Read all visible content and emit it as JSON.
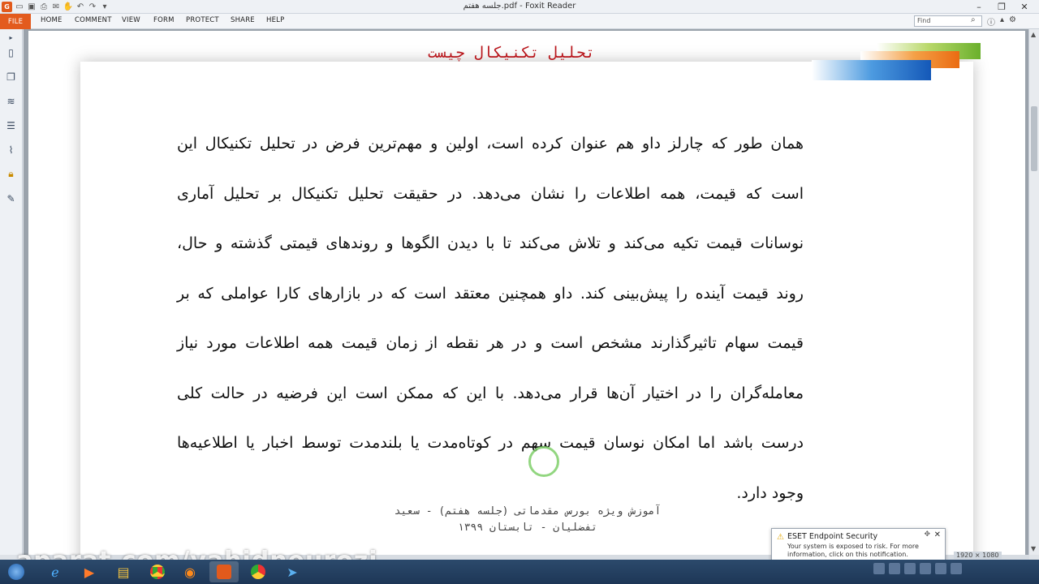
{
  "window": {
    "title": "جلسه هفتم.pdf - Foxit Reader",
    "app_icon_label": "G"
  },
  "ribbon": {
    "tabs": [
      "FILE",
      "HOME",
      "COMMENT",
      "VIEW",
      "FORM",
      "PROTECT",
      "SHARE",
      "HELP"
    ],
    "find_placeholder": "Find"
  },
  "sidebar": {
    "icons": [
      "bookmark-icon",
      "pages-icon",
      "layers-icon",
      "comments-icon",
      "attachments-icon",
      "lock-icon",
      "signature-icon"
    ]
  },
  "document": {
    "title": "تحلیل تکنیکال چیست",
    "lines": [
      "همان طور که چارلز داو هم عنوان کرده است، اولین و مهم‌ترین فرض در تحلیل تکنیکال این",
      "است که قیمت، همه اطلاعات را نشان می‌دهد. در حقیقت تحلیل تکنیکال بر تحلیل آماری",
      "نوسانات قیمت تکیه می‌کند و تلاش می‌کند تا با دیدن الگوها و روندهای قیمتی گذشته و حال،",
      "روند قیمت آینده را پیش‌بینی کند. داو همچنین معتقد است که در بازارهای کارا عواملی که بر",
      "قیمت سهام تاثیرگذارند مشخص است و در هر نقطه از زمان قیمت همه اطلاعات مورد نیاز",
      "معامله‌گران را در اختیار آن‌ها قرار می‌دهد. با این که ممکن است این فرضیه در حالت کلی",
      "درست باشد اما امکان نوسان قیمت سهم در کوتاه‌مدت یا بلندمدت توسط اخبار یا اطلاعیه‌ها",
      "وجود دارد."
    ],
    "footer_line1": "آموزش ویژه بورس مقدماتی (جلسه هفتم) - سعید",
    "footer_line2": "تفضلیان - تابستان ۱۳۹۹"
  },
  "notification": {
    "title": "ESET Endpoint Security",
    "body": "Your system is exposed to risk. For more information, click on this notification."
  },
  "watermark": "aparat.com/vahidneurozi",
  "status": {
    "resolution": "1920 × 1080"
  },
  "taskbar": {
    "items": [
      "start-icon",
      "ie-icon",
      "media-icon",
      "explorer-icon",
      "chrome-icon",
      "firefox-icon",
      "foxit-icon",
      "chrome2-icon",
      "telegram-icon"
    ]
  }
}
